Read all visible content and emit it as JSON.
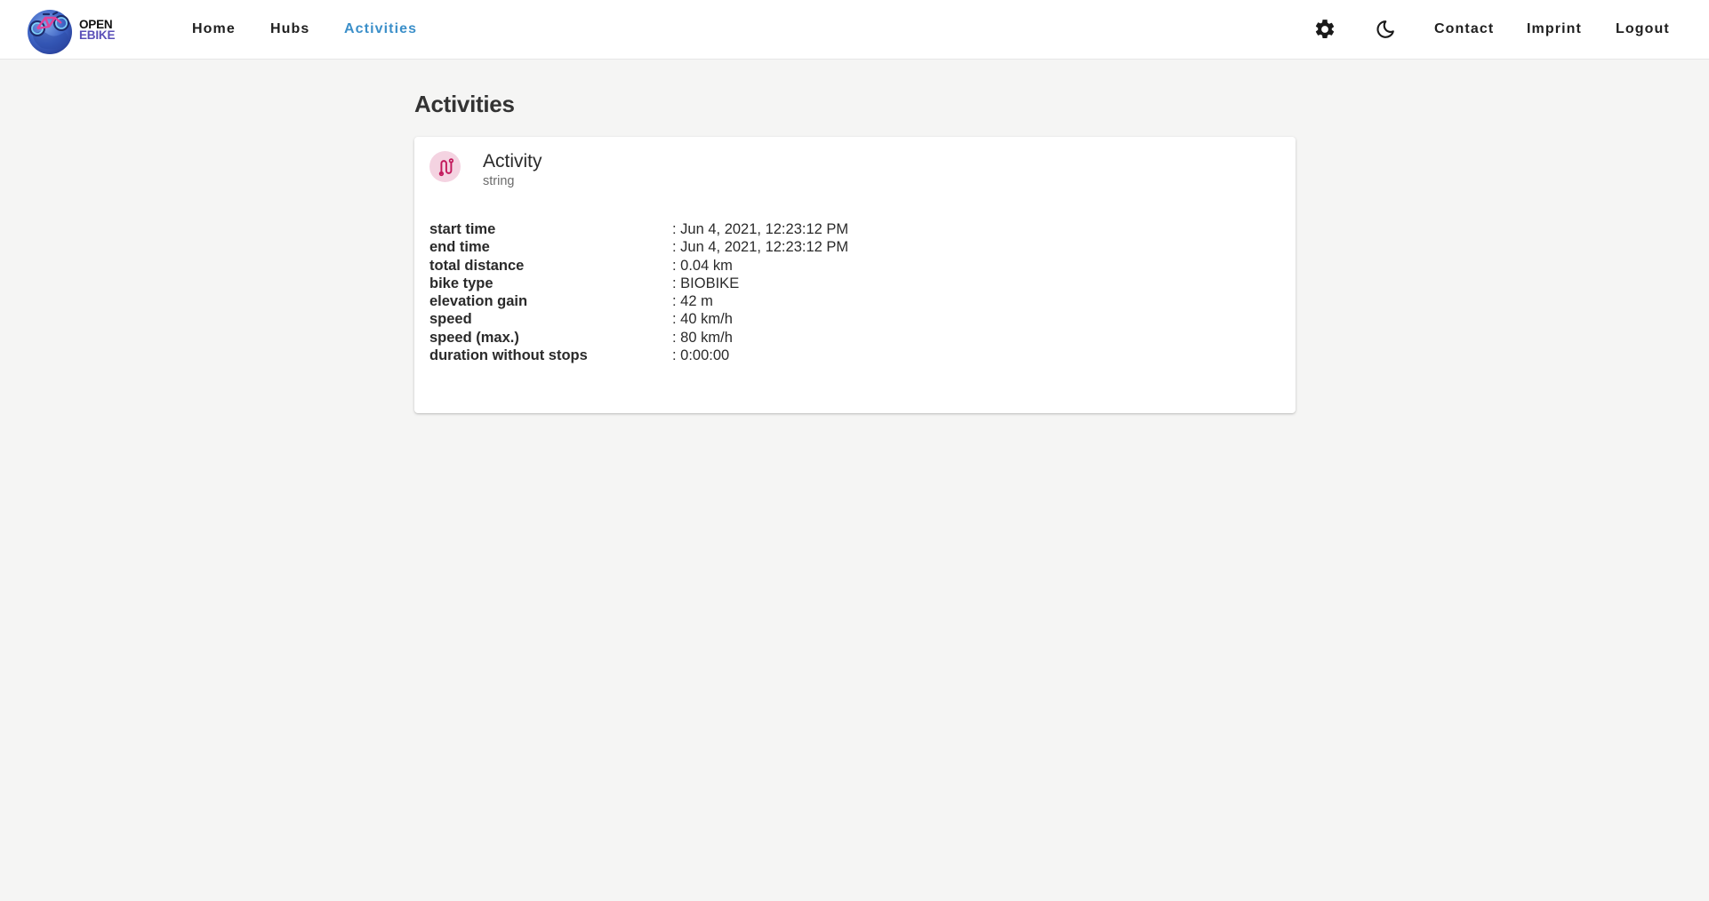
{
  "brand": {
    "line1": "OPEN",
    "line2": "EBIKE",
    "logo_icon": "bicycle-globe-logo"
  },
  "nav": {
    "home": "Home",
    "hubs": "Hubs",
    "activities": "Activities",
    "active": "activities",
    "active_color": "#3b8fc9"
  },
  "toolbar": {
    "settings_icon": "gear-icon",
    "theme_icon": "moon-icon",
    "contact": "Contact",
    "imprint": "Imprint",
    "logout": "Logout"
  },
  "page": {
    "title": "Activities"
  },
  "card": {
    "icon": "route-icon",
    "icon_color": "#c2185b",
    "avatar_bg": "#f4d3e1",
    "title": "Activity",
    "subtitle": "string",
    "details": [
      {
        "label": "start time",
        "value": "Jun 4, 2021, 12:23:12 PM"
      },
      {
        "label": "end time",
        "value": "Jun 4, 2021, 12:23:12 PM"
      },
      {
        "label": "total distance",
        "value": "0.04 km"
      },
      {
        "label": "bike type",
        "value": "BIOBIKE"
      },
      {
        "label": "elevation gain",
        "value": "42 m"
      },
      {
        "label": "speed",
        "value": "40 km/h"
      },
      {
        "label": "speed (max.)",
        "value": "80 km/h"
      },
      {
        "label": "duration without stops",
        "value": "0:00:00"
      }
    ]
  }
}
